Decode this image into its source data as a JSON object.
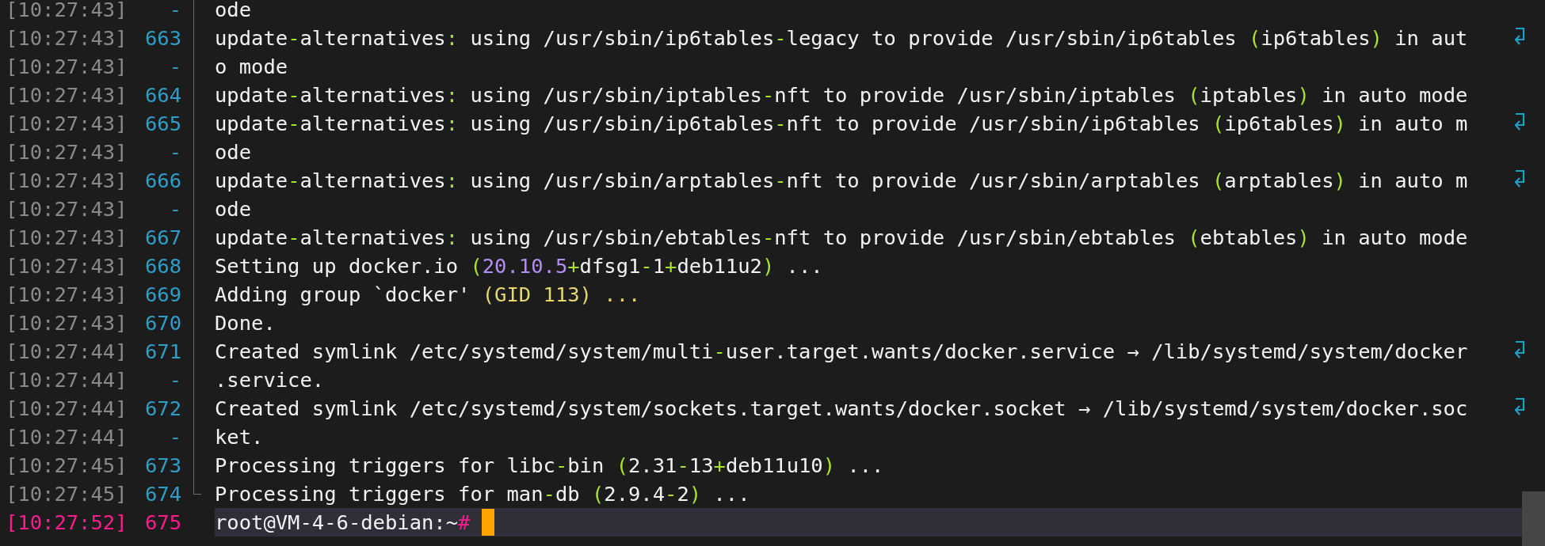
{
  "terminal": {
    "lines": [
      {
        "time": "[10:27:43]",
        "number": "-",
        "wrapped": false,
        "segments": [
          {
            "text": "ode",
            "kind": "plain"
          }
        ]
      },
      {
        "time": "[10:27:43]",
        "number": "663",
        "wrapped": true,
        "segments": [
          {
            "text": "update-alternatives: using /usr/sbin/ip6tables-legacy to provide /usr/sbin/ip6tables (ip6tables) in aut",
            "kind": "plain"
          }
        ]
      },
      {
        "time": "[10:27:43]",
        "number": "-",
        "wrapped": false,
        "segments": [
          {
            "text": "o mode",
            "kind": "plain"
          }
        ]
      },
      {
        "time": "[10:27:43]",
        "number": "664",
        "wrapped": false,
        "segments": [
          {
            "text": "update-alternatives: using /usr/sbin/iptables-nft to provide /usr/sbin/iptables (iptables) in auto mode",
            "kind": "plain"
          }
        ]
      },
      {
        "time": "[10:27:43]",
        "number": "665",
        "wrapped": true,
        "segments": [
          {
            "text": "update-alternatives: using /usr/sbin/ip6tables-nft to provide /usr/sbin/ip6tables (ip6tables) in auto m",
            "kind": "plain"
          }
        ]
      },
      {
        "time": "[10:27:43]",
        "number": "-",
        "wrapped": false,
        "segments": [
          {
            "text": "ode",
            "kind": "plain"
          }
        ]
      },
      {
        "time": "[10:27:43]",
        "number": "666",
        "wrapped": true,
        "segments": [
          {
            "text": "update-alternatives: using /usr/sbin/arptables-nft to provide /usr/sbin/arptables (arptables) in auto m",
            "kind": "plain"
          }
        ]
      },
      {
        "time": "[10:27:43]",
        "number": "-",
        "wrapped": false,
        "segments": [
          {
            "text": "ode",
            "kind": "plain"
          }
        ]
      },
      {
        "time": "[10:27:43]",
        "number": "667",
        "wrapped": false,
        "segments": [
          {
            "text": "update-alternatives: using /usr/sbin/ebtables-nft to provide /usr/sbin/ebtables (ebtables) in auto mode",
            "kind": "plain"
          }
        ]
      },
      {
        "time": "[10:27:43]",
        "number": "668",
        "wrapped": false,
        "segments": [
          {
            "text": "Setting up docker.io (",
            "kind": "plain"
          },
          {
            "text": "20.10.5",
            "kind": "version"
          },
          {
            "text": "+dfsg1-1+deb11u2) ...",
            "kind": "plain"
          }
        ]
      },
      {
        "time": "[10:27:43]",
        "number": "669",
        "wrapped": false,
        "segments": [
          {
            "text": "Adding group `docker' ",
            "kind": "plain"
          },
          {
            "text": "(GID 113) ...",
            "kind": "quoted"
          }
        ]
      },
      {
        "time": "[10:27:43]",
        "number": "670",
        "wrapped": false,
        "segments": [
          {
            "text": "Done.",
            "kind": "plain"
          }
        ]
      },
      {
        "time": "[10:27:44]",
        "number": "671",
        "wrapped": true,
        "segments": [
          {
            "text": "Created symlink /etc/systemd/system/multi-user.target.wants/docker.service → /lib/systemd/system/docker",
            "kind": "plain"
          }
        ]
      },
      {
        "time": "[10:27:44]",
        "number": "-",
        "wrapped": false,
        "segments": [
          {
            "text": ".service.",
            "kind": "plain"
          }
        ]
      },
      {
        "time": "[10:27:44]",
        "number": "672",
        "wrapped": true,
        "segments": [
          {
            "text": "Created symlink /etc/systemd/system/sockets.target.wants/docker.socket → /lib/systemd/system/docker.soc",
            "kind": "plain"
          }
        ]
      },
      {
        "time": "[10:27:44]",
        "number": "-",
        "wrapped": false,
        "segments": [
          {
            "text": "ket.",
            "kind": "plain"
          }
        ]
      },
      {
        "time": "[10:27:45]",
        "number": "673",
        "wrapped": false,
        "segments": [
          {
            "text": "Processing triggers for libc-bin (2.31-13+deb11u10) ...",
            "kind": "plain"
          }
        ]
      },
      {
        "time": "[10:27:45]",
        "number": "674",
        "wrapped": false,
        "segments": [
          {
            "text": "Processing triggers for man-db (2.9.4-2) ...",
            "kind": "plain"
          }
        ]
      }
    ],
    "prompt": {
      "time": "[10:27:52]",
      "number": "675",
      "text": "root@VM-4-6-debian:~",
      "symbol": "#"
    }
  }
}
